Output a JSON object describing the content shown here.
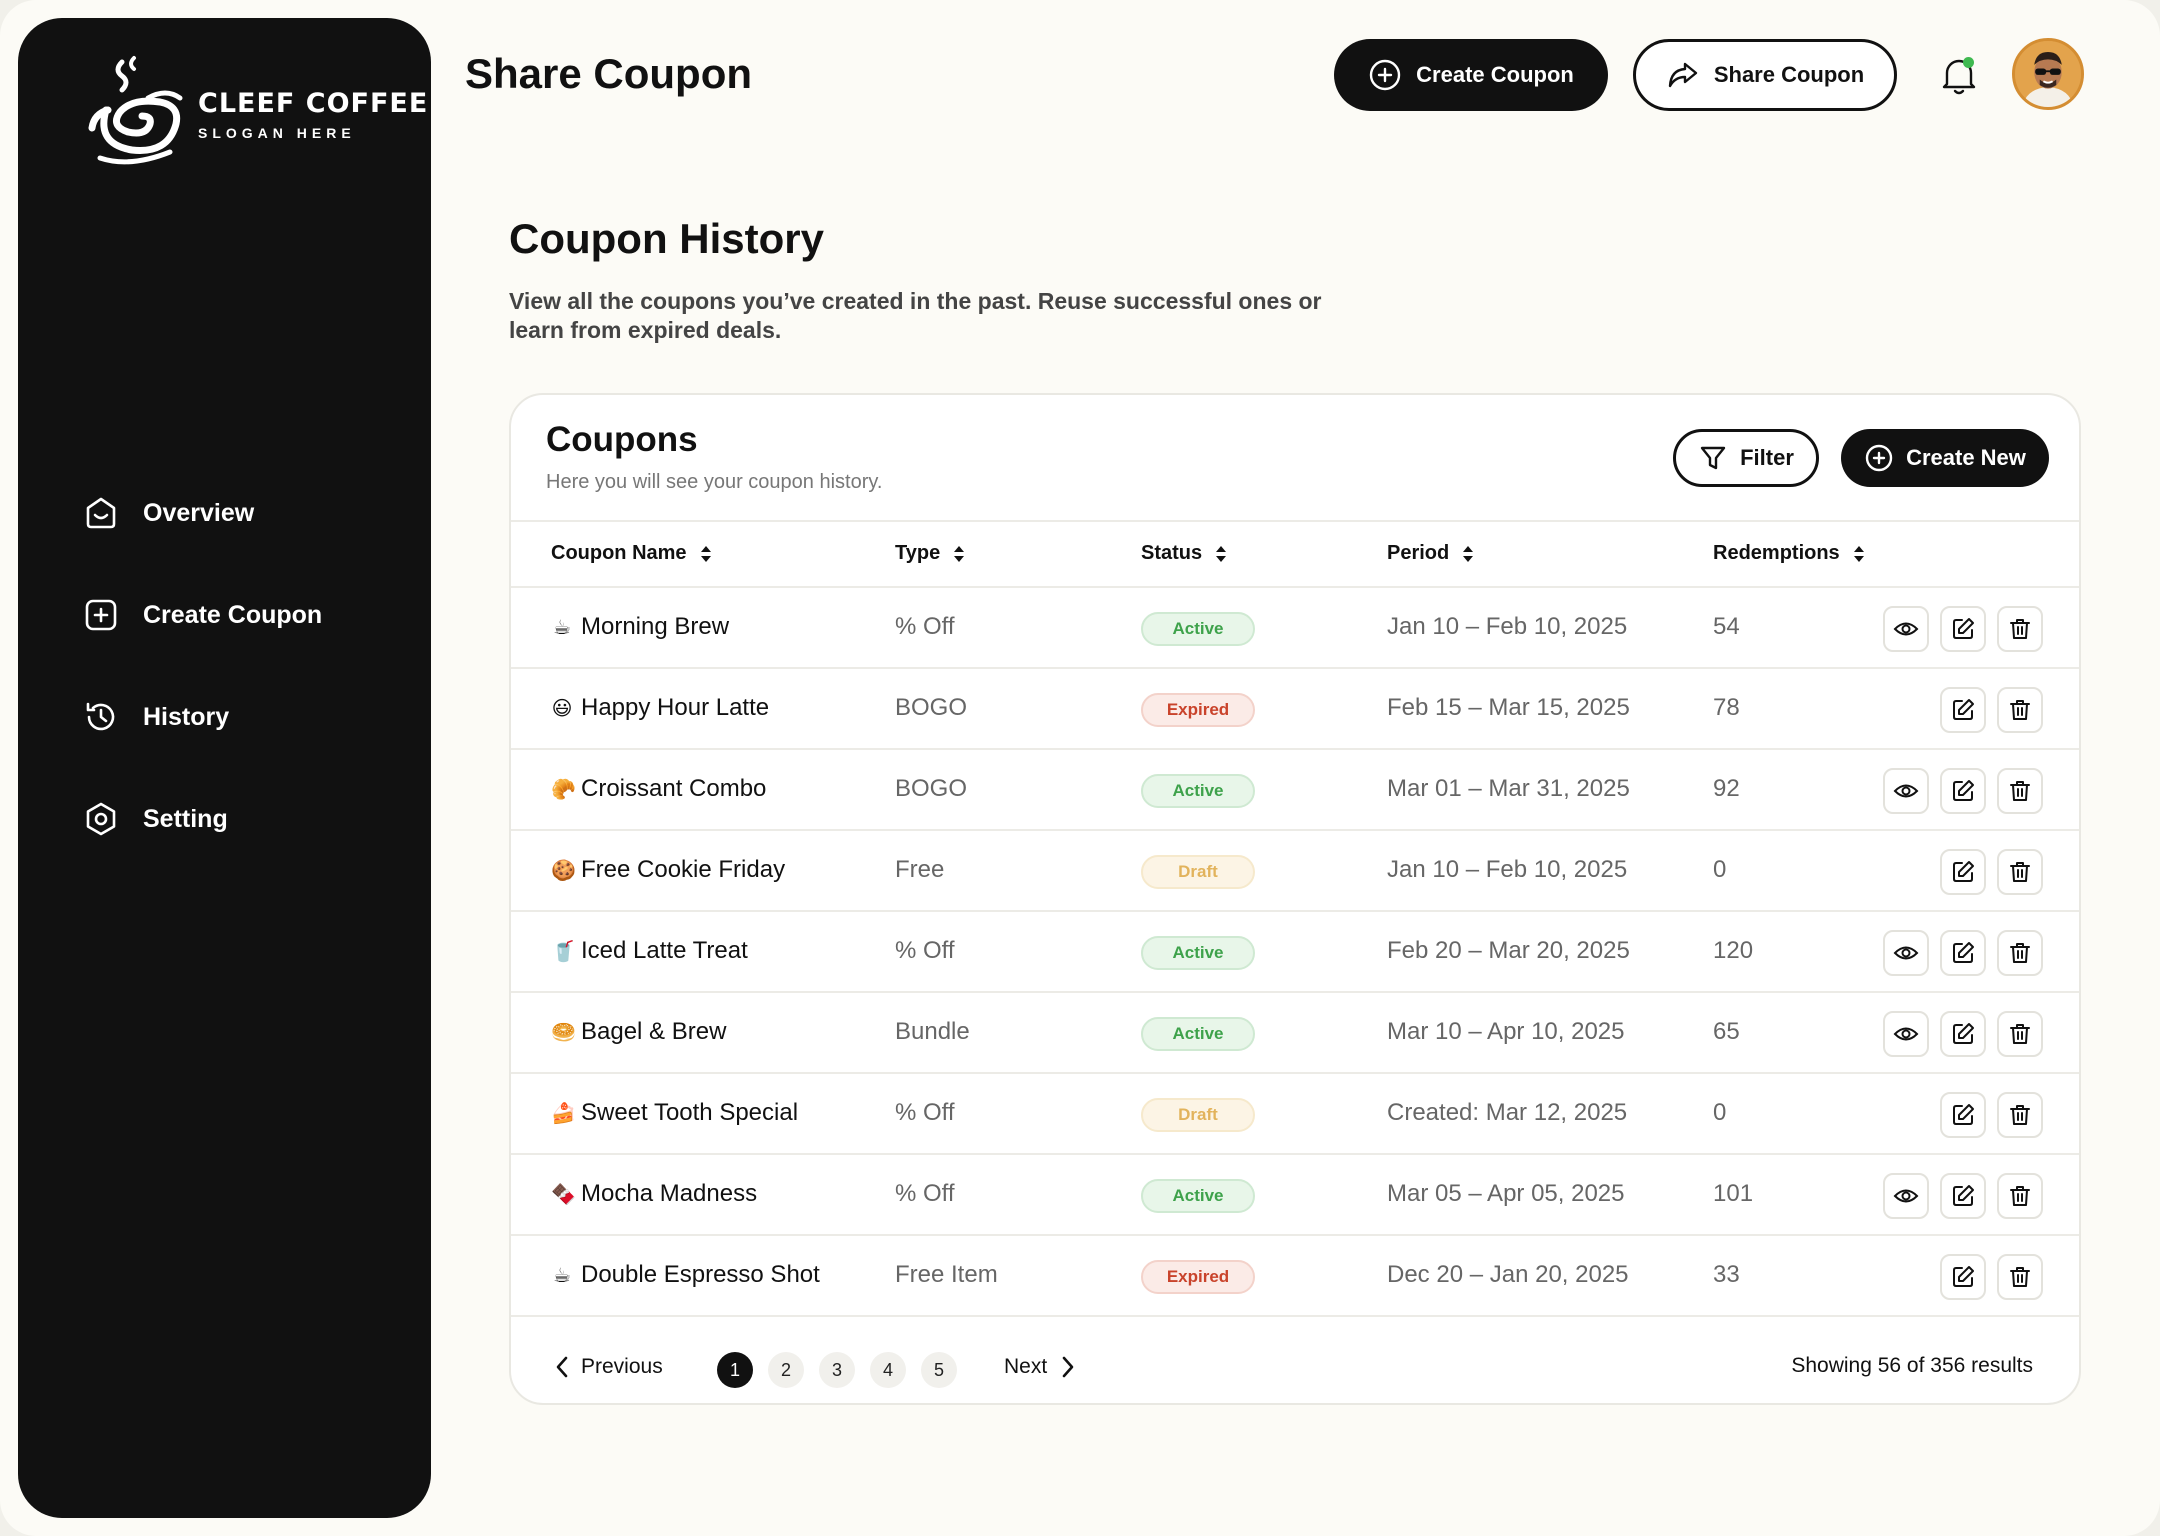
{
  "brand": {
    "name": "CLEEF COFFEE",
    "slogan": "SLOGAN HERE"
  },
  "sidebar": {
    "items": [
      {
        "label": "Overview",
        "icon": "overview-icon"
      },
      {
        "label": "Create Coupon",
        "icon": "plus-square-icon"
      },
      {
        "label": "History",
        "icon": "history-icon"
      },
      {
        "label": "Setting",
        "icon": "settings-icon"
      }
    ]
  },
  "header": {
    "title": "Share Coupon",
    "create_label": "Create Coupon",
    "share_label": "Share Coupon"
  },
  "section": {
    "title": "Coupon History",
    "description": "View all the coupons you’ve created in the past. Reuse successful ones or learn from expired deals."
  },
  "card": {
    "title": "Coupons",
    "subtitle": "Here you will see your coupon history.",
    "filter_label": "Filter",
    "create_new_label": "Create New"
  },
  "table": {
    "columns": [
      "Coupon Name",
      "Type",
      "Status",
      "Period",
      "Redemptions"
    ],
    "rows": [
      {
        "emoji": "☕",
        "name": "Morning Brew",
        "type": "% Off",
        "status": "Active",
        "period": "Jan 10 – Feb 10, 2025",
        "redemptions": "54",
        "viewable": true
      },
      {
        "emoji": "😃",
        "name": "Happy Hour Latte",
        "type": "BOGO",
        "status": "Expired",
        "period": "Feb 15 – Mar 15, 2025",
        "redemptions": "78",
        "viewable": false
      },
      {
        "emoji": "🥐",
        "name": "Croissant Combo",
        "type": "BOGO",
        "status": "Active",
        "period": "Mar 01 – Mar 31, 2025",
        "redemptions": "92",
        "viewable": true
      },
      {
        "emoji": "🍪",
        "name": "Free Cookie Friday",
        "type": "Free",
        "status": "Draft",
        "period": "Jan 10 – Feb 10, 2025",
        "redemptions": "0",
        "viewable": false
      },
      {
        "emoji": "🥤",
        "name": "Iced Latte Treat",
        "type": "% Off",
        "status": "Active",
        "period": "Feb 20 – Mar 20, 2025",
        "redemptions": "120",
        "viewable": true
      },
      {
        "emoji": "🥯",
        "name": "Bagel & Brew",
        "type": "Bundle",
        "status": "Active",
        "period": "Mar 10 – Apr 10, 2025",
        "redemptions": "65",
        "viewable": true
      },
      {
        "emoji": "🍰",
        "name": "Sweet Tooth Special",
        "type": "% Off",
        "status": "Draft",
        "period": "Created: Mar 12, 2025",
        "redemptions": "0",
        "viewable": false
      },
      {
        "emoji": "🍫",
        "name": "Mocha Madness",
        "type": "% Off",
        "status": "Active",
        "period": "Mar 05 – Apr 05, 2025",
        "redemptions": "101",
        "viewable": true
      },
      {
        "emoji": "☕",
        "name": "Double Espresso Shot",
        "type": "Free Item",
        "status": "Expired",
        "period": "Dec 20 – Jan 20, 2025",
        "redemptions": "33",
        "viewable": false
      }
    ]
  },
  "pagination": {
    "prev_label": "Previous",
    "next_label": "Next",
    "pages": [
      "1",
      "2",
      "3",
      "4",
      "5"
    ],
    "current": "1",
    "info": "Showing 56 of 356 results"
  },
  "colors": {
    "sidebar_bg": "#111111",
    "active_green": "#3ea24b",
    "expired_red": "#c9432b",
    "draft_amber": "#e2b35c",
    "notification_dot": "#3fb950"
  }
}
